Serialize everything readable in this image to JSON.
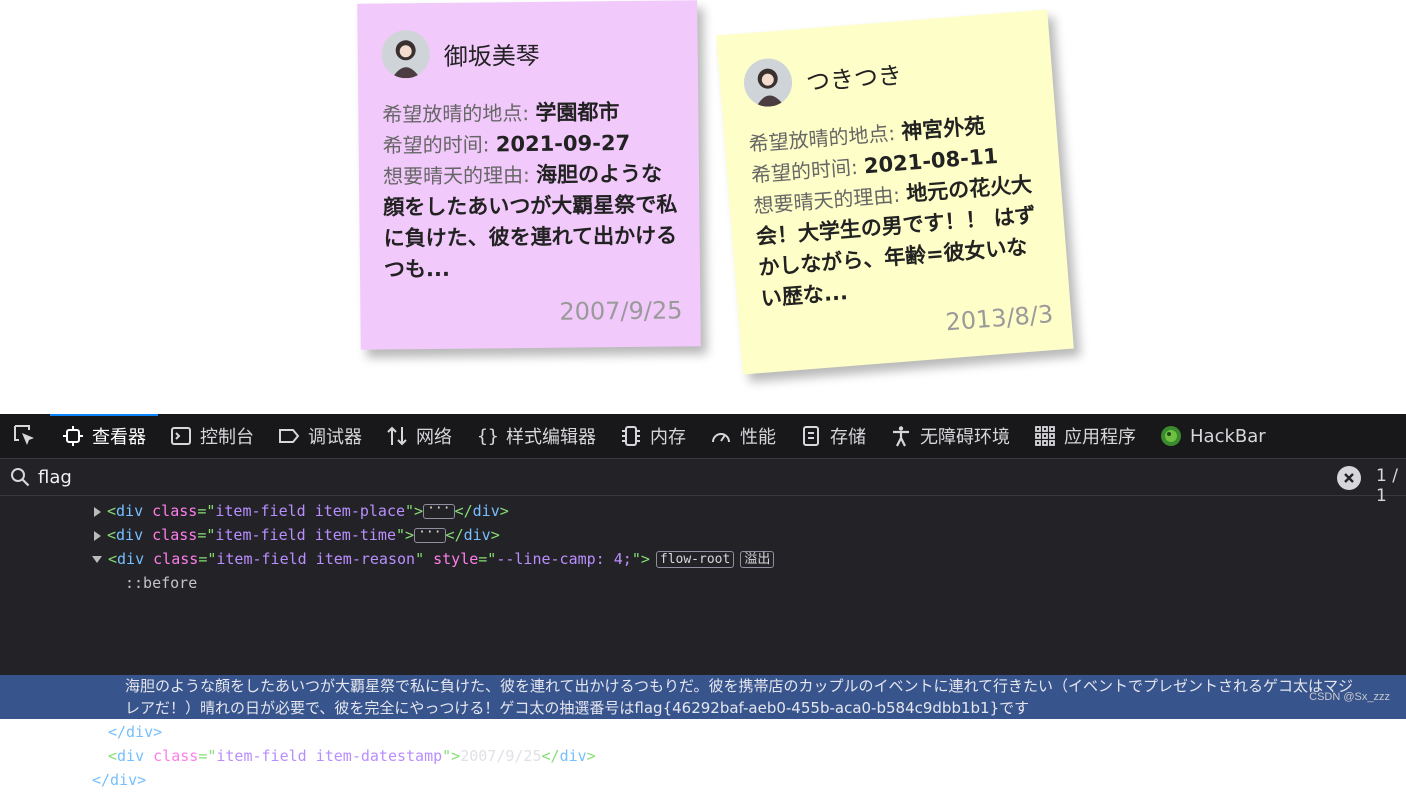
{
  "notes": [
    {
      "name": "御坂美琴",
      "place_label": "希望放晴的地点:",
      "place": "学園都市",
      "time_label": "希望的时间:",
      "time": "2021-09-27",
      "reason_label": "想要晴天的理由:",
      "reason": "海胆のような顔をしたあいつが大覇星祭で私に負けた、彼を連れて出かけるつも...",
      "date": "2007/9/25",
      "color": "#f1c9fb"
    },
    {
      "name": "つきつき",
      "place_label": "希望放晴的地点:",
      "place": "神宮外苑",
      "time_label": "希望的时间:",
      "time": "2021-08-11",
      "reason_label": "想要晴天的理由:",
      "reason": "地元の花火大会！大学生の男です！！ はずかしながら、年齢=彼女いない歴な...",
      "date": "2013/8/3",
      "color": "#fefec8"
    }
  ],
  "devtools": {
    "tabs": [
      {
        "label": "查看器",
        "icon": "inspector-icon",
        "active": true
      },
      {
        "label": "控制台",
        "icon": "console-icon"
      },
      {
        "label": "调试器",
        "icon": "debugger-icon"
      },
      {
        "label": "网络",
        "icon": "network-icon"
      },
      {
        "label": "样式编辑器",
        "icon": "style-editor-icon"
      },
      {
        "label": "内存",
        "icon": "memory-icon"
      },
      {
        "label": "性能",
        "icon": "performance-icon"
      },
      {
        "label": "存储",
        "icon": "storage-icon"
      },
      {
        "label": "无障碍环境",
        "icon": "accessibility-icon"
      },
      {
        "label": "应用程序",
        "icon": "application-icon"
      },
      {
        "label": "HackBar",
        "icon": "hackbar-icon"
      }
    ],
    "search": {
      "value": "flag",
      "count": "1 / 1"
    },
    "tree": {
      "row1": {
        "tag": "div",
        "attr": "class",
        "value": "item-field item-place"
      },
      "row2": {
        "tag": "div",
        "attr": "class",
        "value": "item-field item-time"
      },
      "row3": {
        "tag": "div",
        "attr": "class",
        "value": "item-field item-reason",
        "attr2": "style",
        "value2": "--line-camp: 4;",
        "badge1": "flow-root",
        "badge2": "溢出"
      },
      "pseudo": "::before",
      "selected_line1": "海胆のような顔をしたあいつが大覇星祭で私に負けた、彼を連れて出かけるつもりだ。彼を携帯店のカップルのイベントに連れて行きたい（イベントでプレゼントされるゲコ太はマジ",
      "selected_line2": "レアだ！）晴れの日が必要で、彼を完全にやっつける！ゲコ太の抽選番号はflag{46292baf-aeb0-455b-aca0-b584c9dbb1b1}です",
      "close_div": "</div>",
      "row_date": {
        "tag": "div",
        "attr": "class",
        "value": "item-field item-datestamp",
        "text": "2007/9/25"
      },
      "close_outer": "</div>"
    }
  },
  "watermark": "CSDN @Sx_zzz"
}
